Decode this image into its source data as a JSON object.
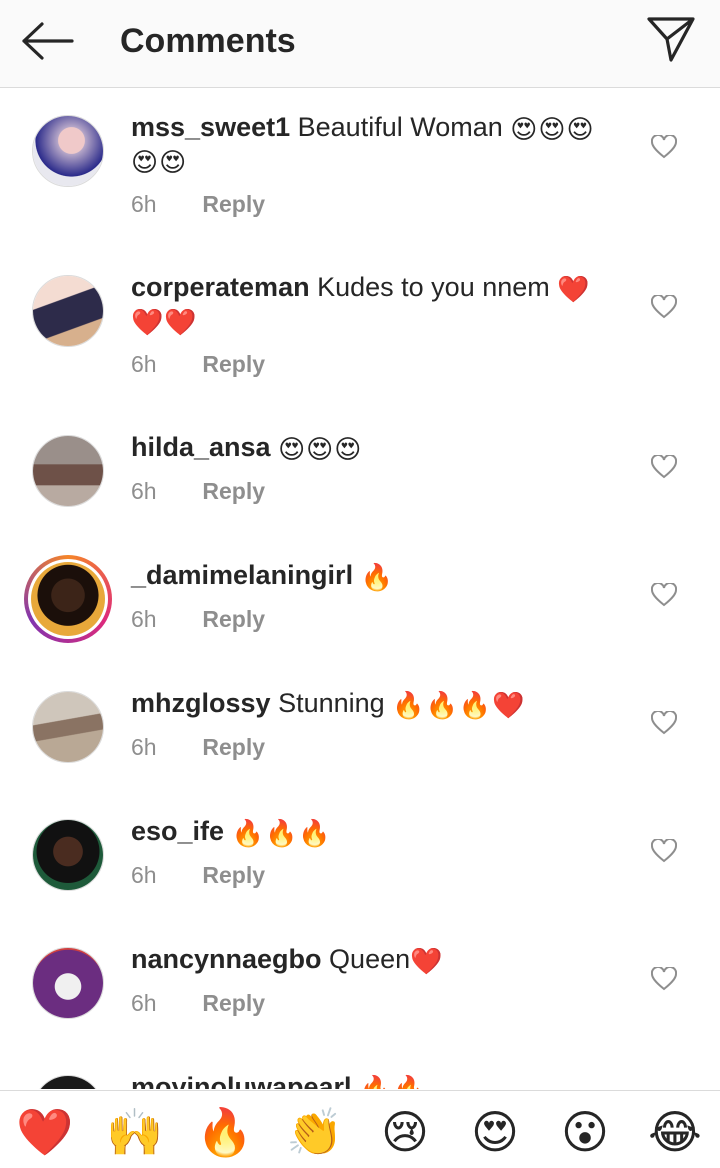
{
  "header": {
    "title": "Comments",
    "back_icon": "arrow-left-icon",
    "share_icon": "paper-plane-icon"
  },
  "colors": {
    "text": "#262626",
    "muted": "#8e8e8e",
    "divider": "#dbdbdb",
    "heart": "#e0171e"
  },
  "comments": [
    {
      "username": "mss_sweet1",
      "text": "Beautiful Woman ",
      "emojis": "😍😍😍",
      "line2": "😍😍",
      "time": "6h",
      "reply": "Reply"
    },
    {
      "username": "corperateman",
      "text": "Kudes to you nnem ",
      "emojis": "❤️",
      "line2": "❤️❤️",
      "time": "6h",
      "reply": "Reply"
    },
    {
      "username": "hilda_ansa",
      "text": "",
      "emojis": "😍😍😍",
      "time": "6h",
      "reply": "Reply"
    },
    {
      "username": "_damimelaningirl",
      "text": "",
      "emojis": "🔥",
      "time": "6h",
      "reply": "Reply"
    },
    {
      "username": "mhzglossy",
      "text": "Stunning ",
      "emojis": "🔥🔥🔥❤️",
      "time": "6h",
      "reply": "Reply"
    },
    {
      "username": "eso_ife",
      "text": "",
      "emojis": "🔥🔥🔥",
      "time": "6h",
      "reply": "Reply"
    },
    {
      "username": "nancynnaegbo",
      "text": "Queen",
      "emojis": "❤️",
      "time": "6h",
      "reply": "Reply"
    },
    {
      "username": "moyinoluwapearl",
      "text": "",
      "emojis": "🔥🔥"
    }
  ],
  "quick_emojis": [
    "❤️",
    "🙌",
    "🔥",
    "👏",
    "😢",
    "😍",
    "😮",
    "😂"
  ]
}
